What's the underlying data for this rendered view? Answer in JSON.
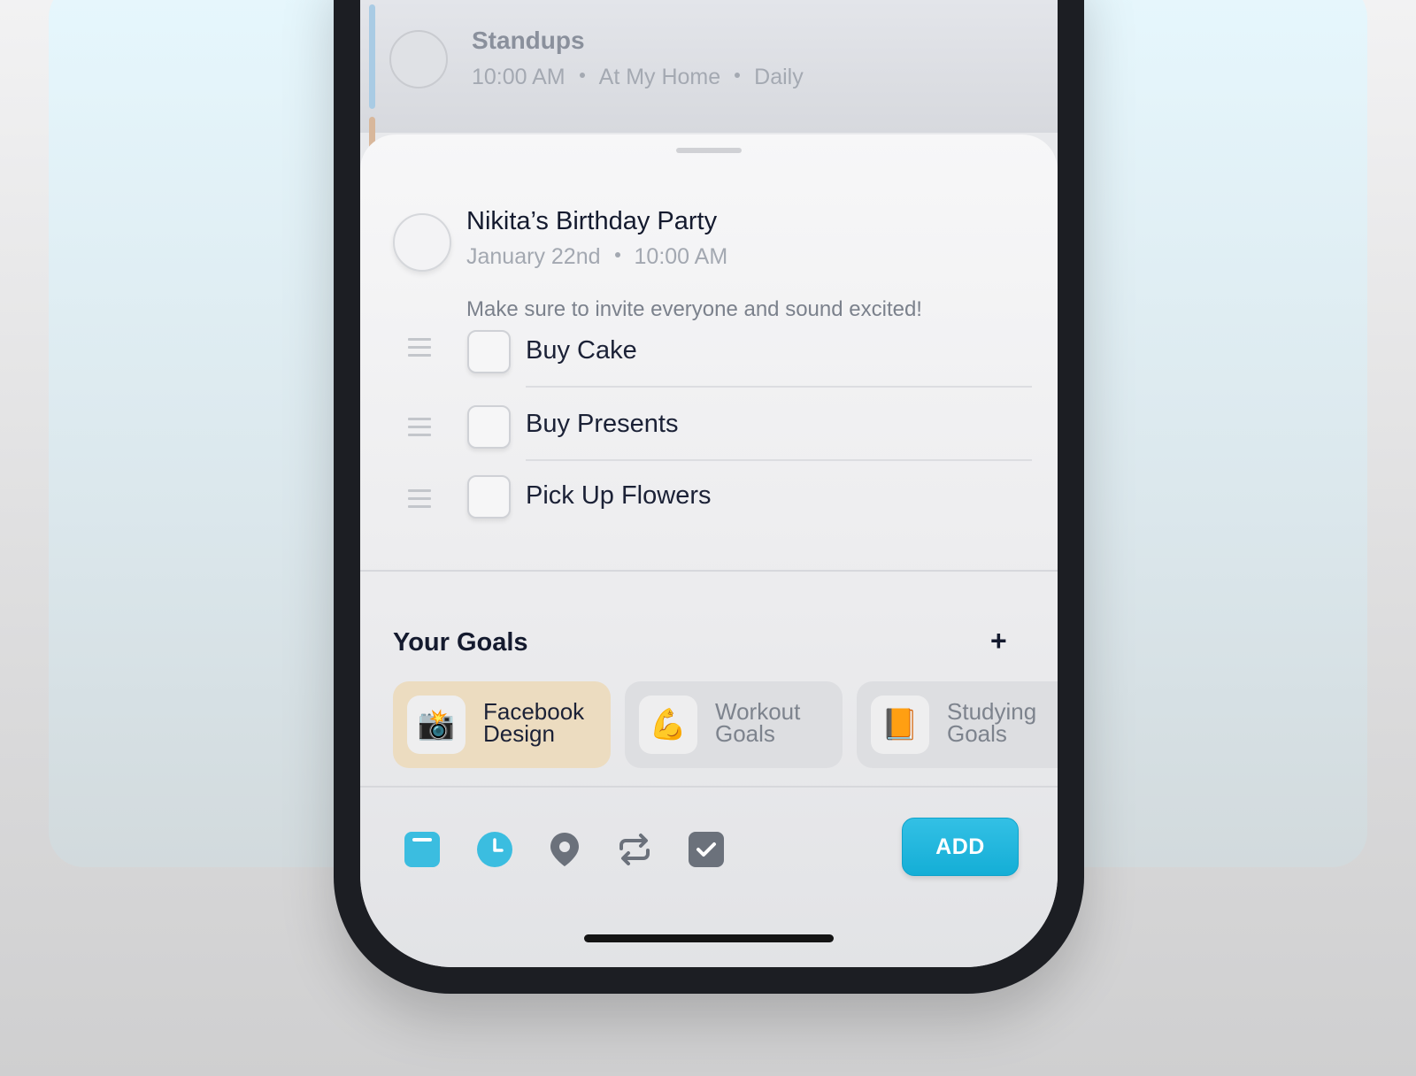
{
  "background_event": {
    "title": "Standups",
    "time": "10:00 AM",
    "location": "At My Home",
    "recurrence": "Daily"
  },
  "event": {
    "title": "Nikita’s Birthday Party",
    "date": "January 22nd",
    "time": "10:00 AM",
    "note": "Make sure to invite everyone and sound excited!"
  },
  "tasks": [
    {
      "label": "Buy Cake",
      "checked": false
    },
    {
      "label": "Buy Presents",
      "checked": false
    },
    {
      "label": "Pick Up Flowers",
      "checked": false
    }
  ],
  "goals": {
    "title": "Your Goals",
    "add_symbol": "+",
    "items": [
      {
        "label_line1": "Facebook",
        "label_line2": "Design",
        "icon": "camera-flash-icon",
        "glyph": "📸",
        "active": true
      },
      {
        "label_line1": "Workout",
        "label_line2": "Goals",
        "icon": "flexed-biceps-icon",
        "glyph": "💪",
        "active": false
      },
      {
        "label_line1": "Studying",
        "label_line2": "Goals",
        "icon": "orange-book-icon",
        "glyph": "📙",
        "active": false
      }
    ]
  },
  "toolbar": {
    "icons": [
      "calendar-icon",
      "clock-icon",
      "location-pin-icon",
      "repeat-icon",
      "checklist-icon"
    ],
    "add_label": "ADD"
  },
  "colors": {
    "accent": "#1fb4dc",
    "icon_gray": "#6b717b",
    "goal_active_bg": "#ecdcc0",
    "text_dark": "#141a2e"
  }
}
